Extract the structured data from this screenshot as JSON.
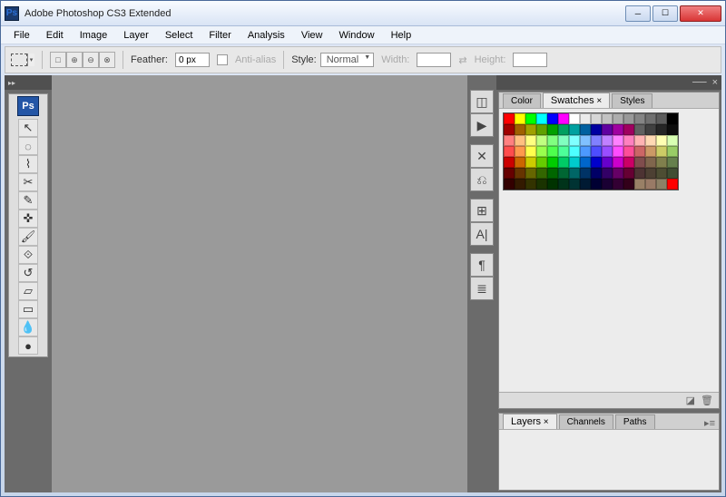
{
  "window": {
    "title": "Adobe Photoshop CS3 Extended"
  },
  "menu": {
    "items": [
      "File",
      "Edit",
      "Image",
      "Layer",
      "Select",
      "Filter",
      "Analysis",
      "View",
      "Window",
      "Help"
    ]
  },
  "options": {
    "feather_label": "Feather:",
    "feather_value": "0 px",
    "anti_alias_label": "Anti-alias",
    "style_label": "Style:",
    "style_value": "Normal",
    "width_label": "Width:",
    "width_value": "",
    "height_label": "Height:",
    "height_value": ""
  },
  "toolbox": {
    "header": "Ps",
    "tools": [
      {
        "name": "move-tool",
        "glyph": "↖"
      },
      {
        "name": "marquee-tool",
        "glyph": "◌"
      },
      {
        "name": "lasso-tool",
        "glyph": "⌇"
      },
      {
        "name": "crop-tool",
        "glyph": "✂"
      },
      {
        "name": "eyedropper-tool",
        "glyph": "✎"
      },
      {
        "name": "healing-brush-tool",
        "glyph": "✜"
      },
      {
        "name": "brush-tool",
        "glyph": "🖌"
      },
      {
        "name": "clone-stamp-tool",
        "glyph": "⟐"
      },
      {
        "name": "history-brush-tool",
        "glyph": "↺"
      },
      {
        "name": "eraser-tool",
        "glyph": "▱"
      },
      {
        "name": "gradient-tool",
        "glyph": "▭"
      },
      {
        "name": "blur-tool",
        "glyph": "💧"
      },
      {
        "name": "dodge-tool",
        "glyph": "●"
      }
    ]
  },
  "dock_icons": [
    {
      "name": "navigator-icon",
      "glyph": "◫"
    },
    {
      "name": "histogram-icon",
      "glyph": "▶"
    },
    {
      "name": "info-icon",
      "glyph": "✕"
    },
    {
      "name": "color-icon",
      "glyph": "⎌"
    },
    {
      "name": "swatches-icon",
      "glyph": "⊞"
    },
    {
      "name": "character-icon",
      "glyph": "A|"
    },
    {
      "name": "paragraph-icon",
      "glyph": "¶"
    },
    {
      "name": "layer-comps-icon",
      "glyph": "≣"
    }
  ],
  "swatches_panel": {
    "tabs": [
      "Color",
      "Swatches",
      "Styles"
    ],
    "active_tab": "Swatches",
    "colors": [
      "#ff0000",
      "#ffff00",
      "#00ff00",
      "#00ffff",
      "#0000ff",
      "#ff00ff",
      "#ffffff",
      "#ebebeb",
      "#d6d6d6",
      "#c2c2c2",
      "#adadad",
      "#999999",
      "#858585",
      "#707070",
      "#5c5c5c",
      "#000000",
      "#a00000",
      "#a06000",
      "#a0a000",
      "#60a000",
      "#00a000",
      "#00a060",
      "#00a0a0",
      "#0060a0",
      "#0000a0",
      "#6000a0",
      "#a000a0",
      "#a00060",
      "#606060",
      "#404040",
      "#262626",
      "#0d0d0d",
      "#ff8080",
      "#ffc080",
      "#ffff80",
      "#c0ff80",
      "#80ff80",
      "#80ffc0",
      "#80ffff",
      "#80c0ff",
      "#8080ff",
      "#c080ff",
      "#ff80ff",
      "#ff80c0",
      "#ffb3b3",
      "#ffd9b3",
      "#ffffb3",
      "#d9ffb3",
      "#ff4d4d",
      "#ff994d",
      "#ffff4d",
      "#99ff4d",
      "#4dff4d",
      "#4dff99",
      "#4dffff",
      "#4d99ff",
      "#4d4dff",
      "#994dff",
      "#ff4dff",
      "#ff4d99",
      "#cc6666",
      "#cc9966",
      "#cccc66",
      "#99cc66",
      "#cc0000",
      "#cc6600",
      "#cccc00",
      "#66cc00",
      "#00cc00",
      "#00cc66",
      "#00cccc",
      "#0066cc",
      "#0000cc",
      "#6600cc",
      "#cc00cc",
      "#cc0066",
      "#804d4d",
      "#80664d",
      "#80804d",
      "#66804d",
      "#660000",
      "#663300",
      "#666600",
      "#336600",
      "#006600",
      "#006633",
      "#006666",
      "#003366",
      "#000066",
      "#330066",
      "#660066",
      "#660033",
      "#4d3333",
      "#4d4033",
      "#4d4d33",
      "#404d33",
      "#330000",
      "#331a00",
      "#333300",
      "#1a3300",
      "#003300",
      "#00331a",
      "#003333",
      "#001a33",
      "#000033",
      "#1a0033",
      "#330033",
      "#33001a",
      "#998066",
      "#997a66",
      "#8c8066",
      "#ff0000"
    ]
  },
  "layers_panel": {
    "tabs": [
      "Layers",
      "Channels",
      "Paths"
    ],
    "active_tab": "Layers"
  }
}
